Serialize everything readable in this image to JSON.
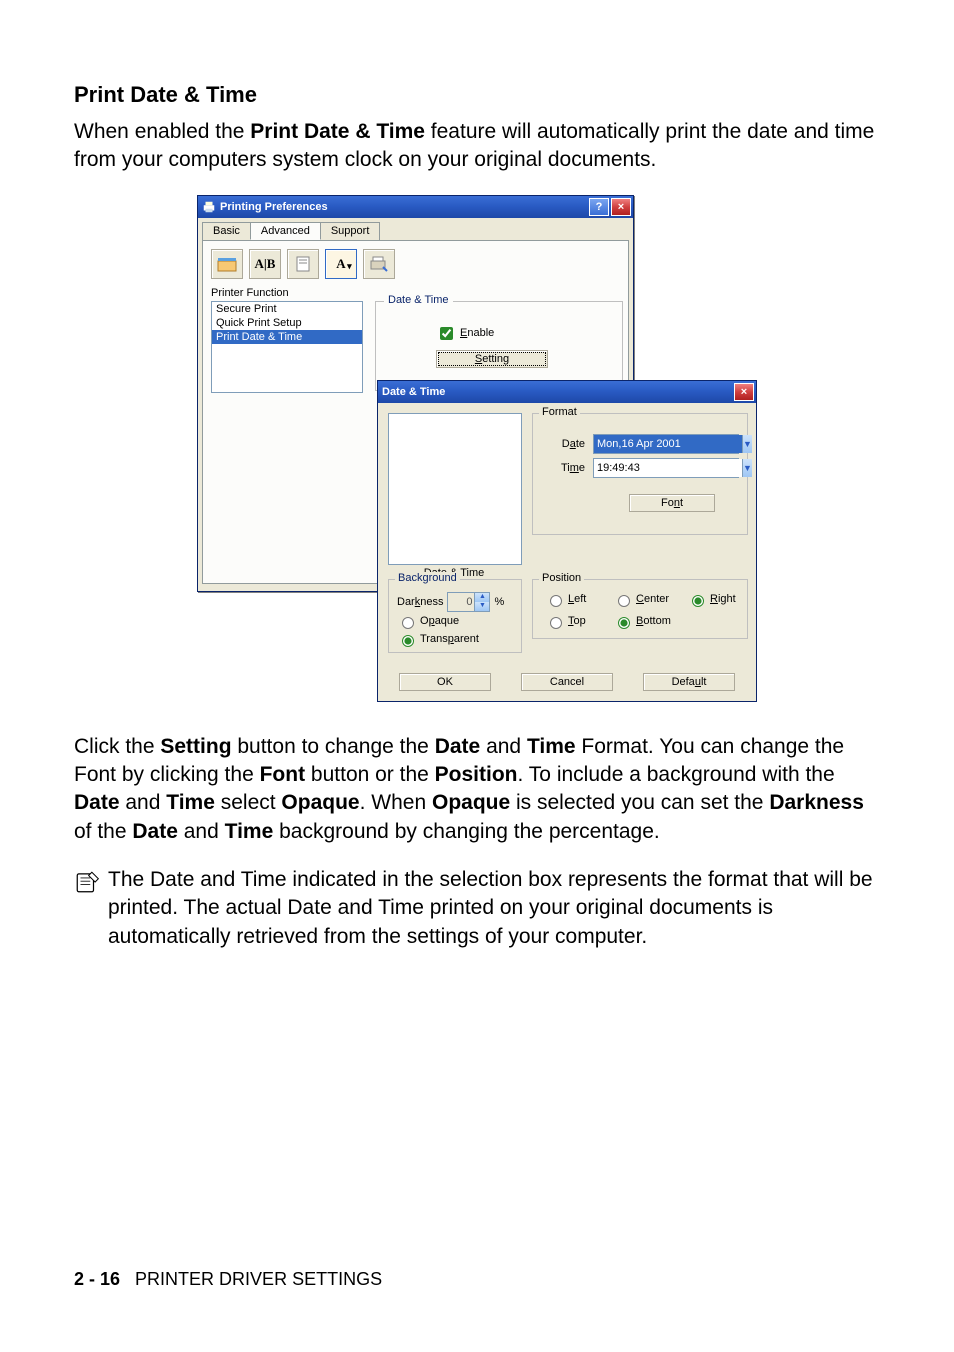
{
  "heading": "Print Date & Time",
  "intro": {
    "pre": "When enabled the ",
    "bold1": "Print Date & Time",
    "post": " feature will automatically print the date and time from your computers system clock on your original documents."
  },
  "pp_window": {
    "title": "Printing Preferences",
    "help_btn": "?",
    "close_btn": "×",
    "tabs": {
      "basic": "Basic",
      "advanced": "Advanced",
      "support": "Support"
    },
    "toolbar_icons": [
      "A|B",
      "A",
      "A▾"
    ],
    "pf_label": "Printer Function",
    "pf_items": [
      "Secure Print",
      "Quick Print Setup",
      "Print Date & Time"
    ],
    "group_label": "Date & Time",
    "enable_label": "Enable",
    "setting_btn": "Setting"
  },
  "dt_dialog": {
    "title": "Date & Time",
    "close_btn": "×",
    "preview_caption": "Date & Time",
    "format": {
      "legend": "Format",
      "date_label": "Date",
      "date_value": "Mon,16 Apr 2001",
      "time_label": "Time",
      "time_value": "19:49:43",
      "font_btn": "Font"
    },
    "position": {
      "legend": "Position",
      "left": "Left",
      "center": "Center",
      "right": "Right",
      "top": "Top",
      "bottom": "Bottom"
    },
    "background": {
      "legend": "Background",
      "darkness_label": "Darkness",
      "darkness_value": "0",
      "percent": "%",
      "opaque": "Opaque",
      "transparent": "Transparent"
    },
    "buttons": {
      "ok": "OK",
      "cancel": "Cancel",
      "default": "Default"
    }
  },
  "para2": {
    "p1": "Click the ",
    "b1": "Setting",
    "p2": " button to change the ",
    "b2": "Date",
    "p3": " and ",
    "b3": "Time",
    "p4": " Format. You can change the Font by clicking the ",
    "b4": "Font",
    "p5": " button or the ",
    "b5": "Position",
    "p6": ". To include a background with the ",
    "b6": "Date",
    "p7": " and ",
    "b7": "Time",
    "p8": " select ",
    "b8": "Opaque",
    "p9": ". When ",
    "b9": "Opaque",
    "p10": " is selected you can set the ",
    "b10": "Darkness",
    "p11": " of the ",
    "b11": "Date",
    "p12": " and ",
    "b12": "Time",
    "p13": " background by changing the percentage."
  },
  "note": "The Date and Time indicated in the selection box represents the format that will be printed. The actual Date and Time printed on your original documents is automatically retrieved from the settings of your computer.",
  "footer": {
    "page": "2 - 16",
    "title": "PRINTER DRIVER SETTINGS"
  }
}
